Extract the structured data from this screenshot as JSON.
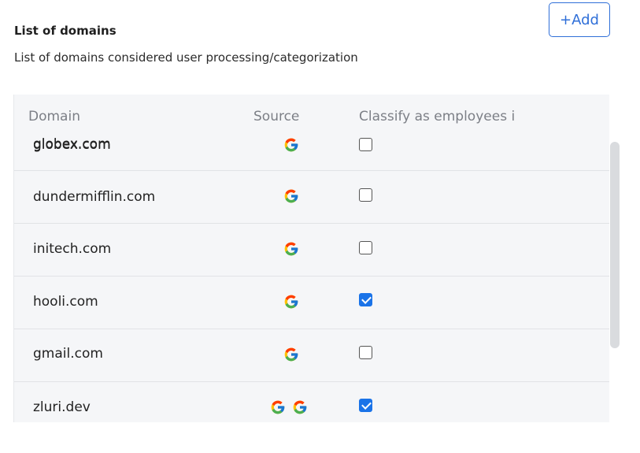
{
  "header": {
    "title": "List of domains",
    "subtitle": "List of domains considered user processing/categorization",
    "add_label": "+Add"
  },
  "table": {
    "columns": [
      "Domain",
      "Source",
      "Classify as employees i"
    ],
    "rows": [
      {
        "domain": "globex.com",
        "sources": [
          "google-icon"
        ],
        "classify": false
      },
      {
        "domain": "dundermifflin.com",
        "sources": [
          "google-icon"
        ],
        "classify": false
      },
      {
        "domain": "initech.com",
        "sources": [
          "google-icon"
        ],
        "classify": false
      },
      {
        "domain": "hooli.com",
        "sources": [
          "google-icon"
        ],
        "classify": true
      },
      {
        "domain": "gmail.com",
        "sources": [
          "google-icon"
        ],
        "classify": false
      },
      {
        "domain": "zluri.dev",
        "sources": [
          "google-icon",
          "google-icon"
        ],
        "classify": true
      }
    ]
  },
  "colors": {
    "accent": "#2f6fd8",
    "checkbox_checked": "#1a73e8",
    "panel_bg": "#f5f6f8",
    "header_text": "#7c7f86"
  }
}
